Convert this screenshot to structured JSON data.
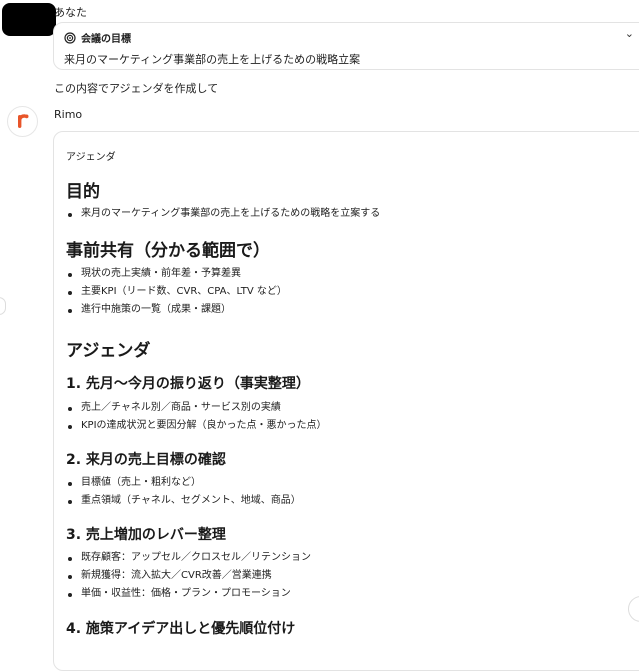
{
  "user": {
    "name": "あなた"
  },
  "goal": {
    "heading": "会議の目標",
    "text": "来月のマーケティング事業部の売上を上げるための戦略立案"
  },
  "user_message": "この内容でアジェンダを作成して",
  "assistant": {
    "name": "Rimo",
    "brand_color": "#e8552a"
  },
  "agenda": {
    "label": "アジェンダ",
    "sections": [
      {
        "title": "目的",
        "items": [
          "来月のマーケティング事業部の売上を上げるための戦略を立案する"
        ]
      },
      {
        "title": "事前共有（分かる範囲で）",
        "items": [
          "現状の売上実績・前年差・予算差異",
          "主要KPI（リード数、CVR、CPA、LTV など）",
          "進行中施策の一覧（成果・課題）"
        ]
      },
      {
        "title": "アジェンダ",
        "items": []
      }
    ],
    "topics": [
      {
        "title": "1. 先月〜今月の振り返り（事実整理）",
        "items": [
          "売上／チャネル別／商品・サービス別の実績",
          "KPIの達成状況と要因分解（良かった点・悪かった点）"
        ]
      },
      {
        "title": "2. 来月の売上目標の確認",
        "items": [
          "目標値（売上・粗利など）",
          "重点領域（チャネル、セグメント、地域、商品）"
        ]
      },
      {
        "title": "3. 売上増加のレバー整理",
        "items": [
          "既存顧客：アップセル／クロスセル／リテンション",
          "新規獲得：流入拡大／CVR改善／営業連携",
          "単価・収益性：価格・プラン・プロモーション"
        ]
      },
      {
        "title": "4. 施策アイデア出しと優先順位付け",
        "items": []
      }
    ]
  }
}
